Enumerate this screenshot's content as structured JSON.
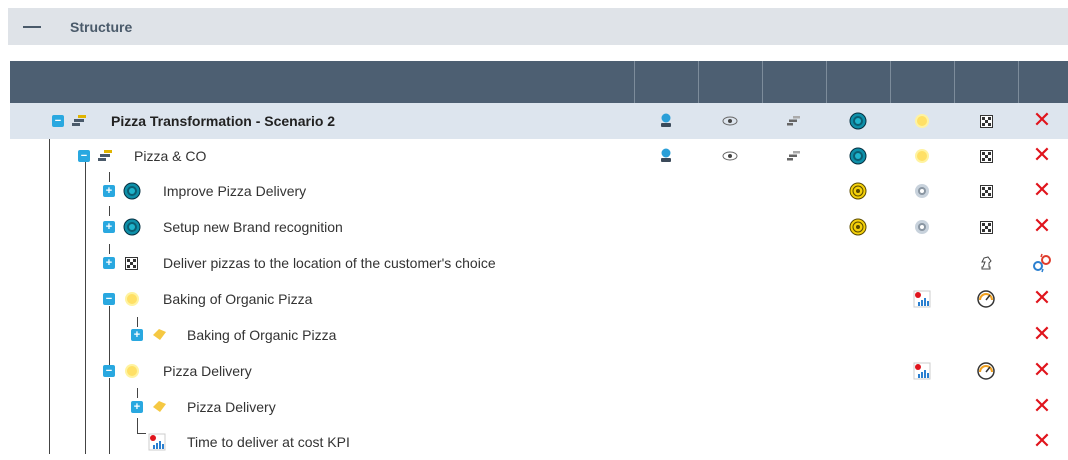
{
  "section": {
    "title": "Structure"
  },
  "rows": [
    {
      "label": "Pizza Transformation - Scenario 2"
    },
    {
      "label": "Pizza & CO"
    },
    {
      "label": "Improve Pizza Delivery"
    },
    {
      "label": "Setup new Brand recognition"
    },
    {
      "label": "Deliver pizzas to the location of the customer's choice"
    },
    {
      "label": "Baking of Organic Pizza"
    },
    {
      "label": "Baking of Organic Pizza"
    },
    {
      "label": "Pizza Delivery"
    },
    {
      "label": "Pizza Delivery"
    },
    {
      "label": "Time to deliver at cost KPI"
    }
  ],
  "toggles": {
    "expand": "+",
    "collapse": "−"
  },
  "colors": {
    "header_bg": "#4d5f72",
    "selected_bg": "#dde5ee",
    "toggle": "#29a8e0",
    "delete": "#e0141c"
  },
  "icons": {
    "delete": "✕"
  }
}
